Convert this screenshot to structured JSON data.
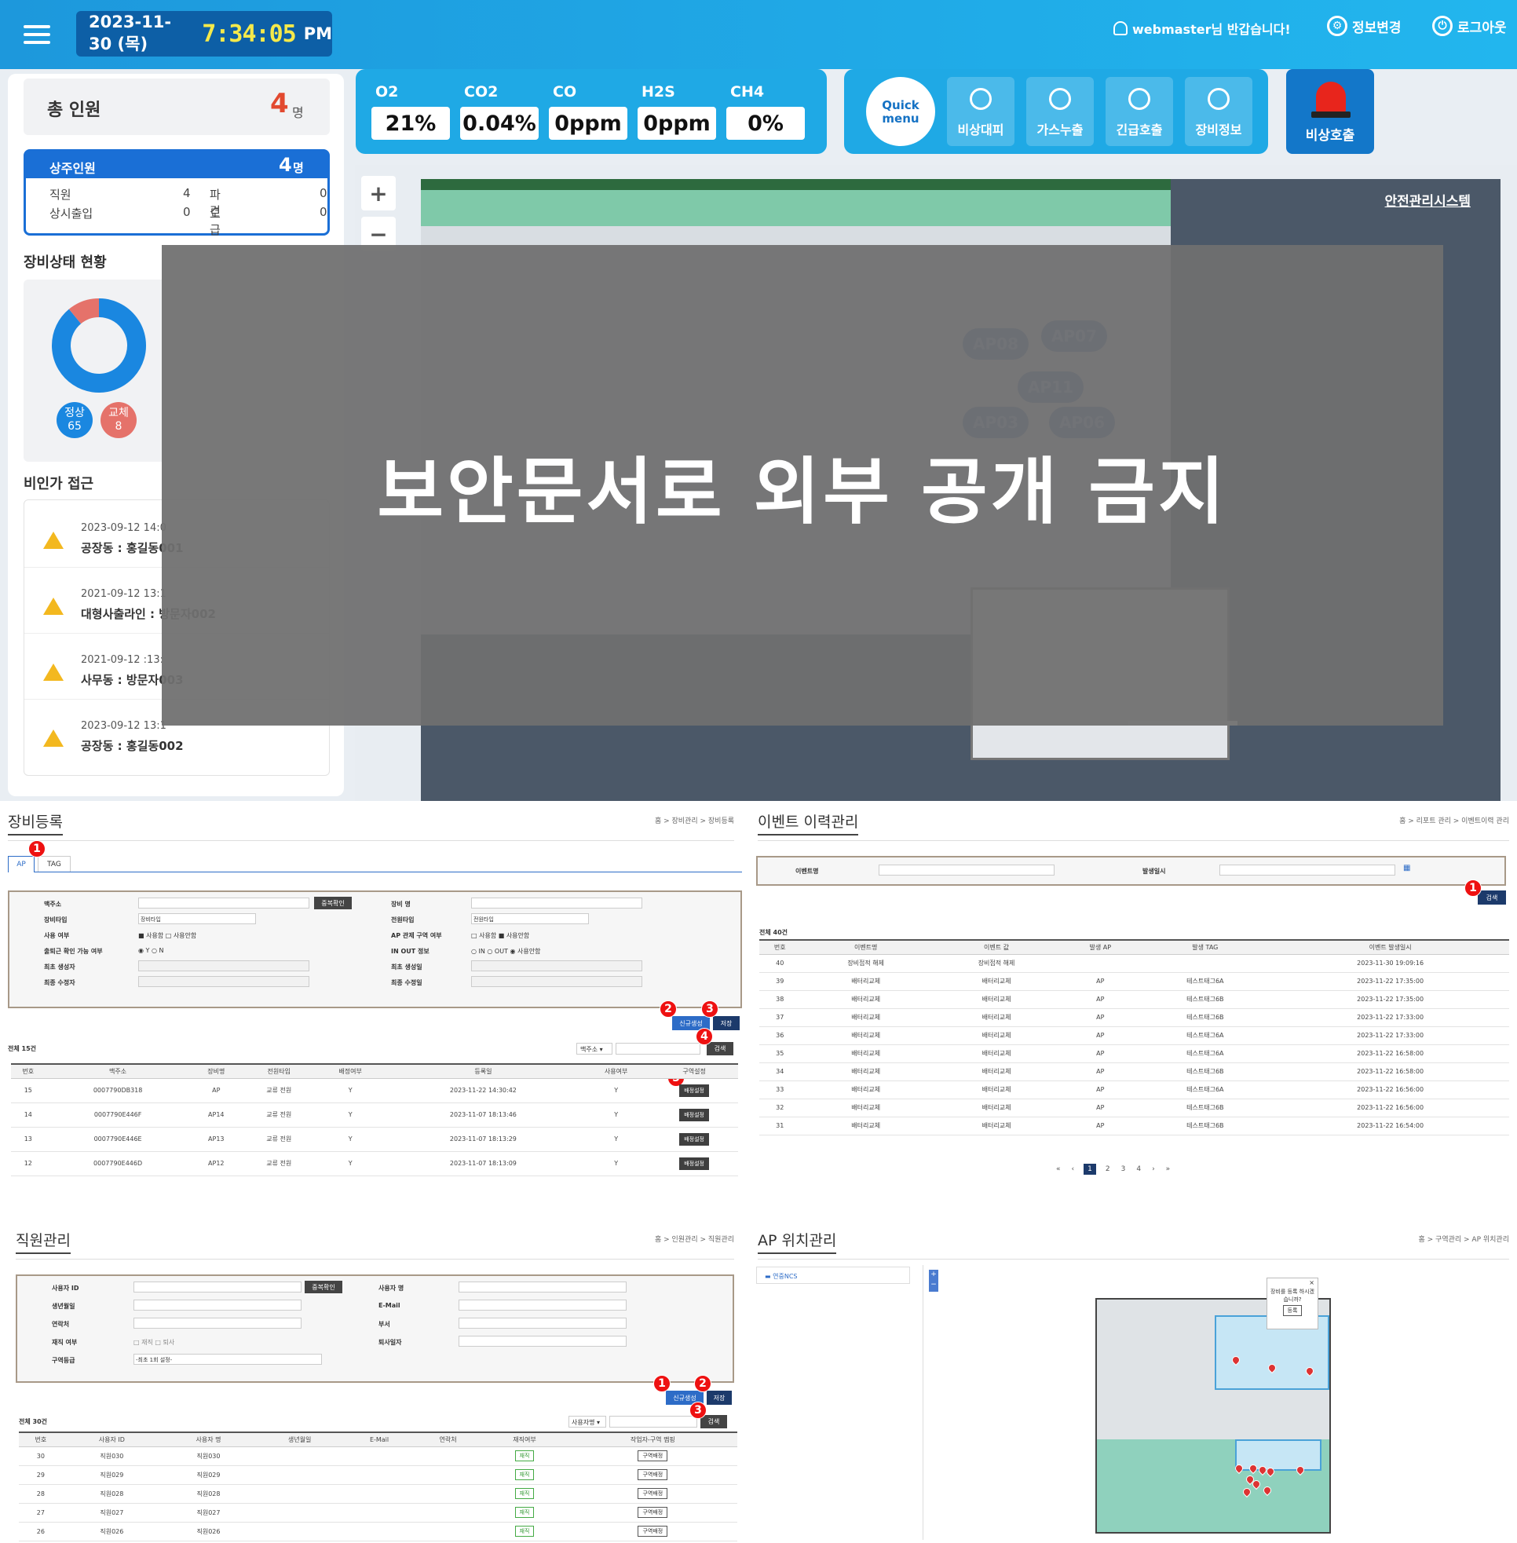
{
  "header": {
    "date": "2023-11-30 (목)",
    "time": "7:34:05",
    "ampm": "PM",
    "user": "webmaster님 반갑습니다!",
    "settings": "정보변경",
    "logout": "로그아웃"
  },
  "total": {
    "label": "총 인원",
    "count": "4",
    "unit": "명"
  },
  "resident": {
    "label": "상주인원",
    "count": "4",
    "unit": "명",
    "rows": [
      {
        "a": "직원",
        "av": "4",
        "b": "파견",
        "bv": "0"
      },
      {
        "a": "상시출입",
        "av": "0",
        "b": "도급",
        "bv": "0"
      }
    ]
  },
  "equip": {
    "title": "장비상태 현황",
    "normal_label": "정상",
    "normal": "65",
    "replace_label": "교체",
    "replace": "8"
  },
  "chart_data": {
    "type": "pie",
    "categories": [
      "정상",
      "교체"
    ],
    "values": [
      65,
      8
    ],
    "colors": [
      "#1a87e0",
      "#e5726a"
    ]
  },
  "intruder": {
    "title": "비인가 접근",
    "items": [
      {
        "time": "2023-09-12 14:0",
        "place": "공장동 : 홍길동001"
      },
      {
        "time": "2021-09-12 13:1",
        "place": "대형사출라인 : 방문자002"
      },
      {
        "time": "2021-09-12 :13:",
        "place": "사무동 : 방문자003"
      },
      {
        "time": "2023-09-12 13:1",
        "place": "공장동 : 홍길동002"
      }
    ]
  },
  "gas": [
    {
      "name": "O2",
      "value": "21%"
    },
    {
      "name": "CO2",
      "value": "0.04%"
    },
    {
      "name": "CO",
      "value": "0ppm"
    },
    {
      "name": "H2S",
      "value": "0ppm"
    },
    {
      "name": "CH4",
      "value": "0%"
    }
  ],
  "quick": {
    "label1": "Quick",
    "label2": "menu",
    "buttons": [
      "비상대피",
      "가스누출",
      "긴급호출",
      "장비정보"
    ],
    "emergency": "비상호출"
  },
  "map": {
    "title": "안전관리시스템",
    "aps": [
      "AP08",
      "AP07",
      "AP11",
      "AP03",
      "AP06"
    ]
  },
  "overlay": "보안문서로 외부 공개 금지",
  "s1": {
    "title": "장비등록",
    "bread": "홈 > 장비관리 > 장비등록",
    "tabs": [
      "AP",
      "TAG"
    ],
    "form": {
      "l": [
        "맥주소",
        "장비타입",
        "사용 여부",
        "출퇴근 확인 가능 여부",
        "최초 생성자",
        "최종 수정자"
      ],
      "r": [
        "장비 명",
        "전원타입",
        "AP 관제 구역 여부",
        "IN OUT 정보",
        "최초 생성일",
        "최종 수정일"
      ],
      "dup": "중복확인",
      "type_sel": "장비타입",
      "power_sel": "전원타입",
      "use": "■ 사용함 □ 사용안함",
      "yn": "◉ Y ○ N",
      "ap_use": "□ 사용함 ■ 사용안함",
      "inout": "○ IN ○ OUT ◉ 사용안함"
    },
    "btn_new": "신규생성",
    "btn_save": "저장",
    "total": "전체 15건",
    "search_sel": "맥주소",
    "search": "검색",
    "cols": [
      "번호",
      "맥주소",
      "장비명",
      "전원타입",
      "배정여부",
      "등록일",
      "사용여부",
      "구역설정"
    ],
    "rows": [
      [
        "15",
        "0007790DB318",
        "AP",
        "교류 전원",
        "Y",
        "2023-11-22 14:30:42",
        "Y",
        "배정설정"
      ],
      [
        "14",
        "0007790E446F",
        "AP14",
        "교류 전원",
        "Y",
        "2023-11-07 18:13:46",
        "Y",
        "배정설정"
      ],
      [
        "13",
        "0007790E446E",
        "AP13",
        "교류 전원",
        "Y",
        "2023-11-07 18:13:29",
        "Y",
        "배정설정"
      ],
      [
        "12",
        "0007790E446D",
        "AP12",
        "교류 전원",
        "Y",
        "2023-11-07 18:13:09",
        "Y",
        "배정설정"
      ]
    ]
  },
  "s2": {
    "title": "이벤트 이력관리",
    "bread": "홈 > 리포트 관리 > 이벤트이력 관리",
    "f1": "이벤트명",
    "f2": "발생일시",
    "search": "검색",
    "total": "전체 40건",
    "cols": [
      "번호",
      "이벤트명",
      "이벤트 값",
      "발생 AP",
      "발생 TAG",
      "이벤트 발생일시"
    ],
    "rows": [
      [
        "40",
        "장비접적 해제",
        "장비접적 해제",
        "",
        "",
        "2023-11-30 19:09:16"
      ],
      [
        "39",
        "배터리교체",
        "배터리교체",
        "AP",
        "테스트태그6A",
        "2023-11-22 17:35:00"
      ],
      [
        "38",
        "배터리교체",
        "배터리교체",
        "AP",
        "테스트태그6B",
        "2023-11-22 17:35:00"
      ],
      [
        "37",
        "배터리교체",
        "배터리교체",
        "AP",
        "테스트태그6B",
        "2023-11-22 17:33:00"
      ],
      [
        "36",
        "배터리교체",
        "배터리교체",
        "AP",
        "테스트태그6A",
        "2023-11-22 17:33:00"
      ],
      [
        "35",
        "배터리교체",
        "배터리교체",
        "AP",
        "테스트태그6A",
        "2023-11-22 16:58:00"
      ],
      [
        "34",
        "배터리교체",
        "배터리교체",
        "AP",
        "테스트태그6B",
        "2023-11-22 16:58:00"
      ],
      [
        "33",
        "배터리교체",
        "배터리교체",
        "AP",
        "테스트태그6A",
        "2023-11-22 16:56:00"
      ],
      [
        "32",
        "배터리교체",
        "배터리교체",
        "AP",
        "테스트태그6B",
        "2023-11-22 16:56:00"
      ],
      [
        "31",
        "배터리교체",
        "배터리교체",
        "AP",
        "테스트태그6B",
        "2023-11-22 16:54:00"
      ]
    ],
    "pages": [
      "«",
      "‹",
      "1",
      "2",
      "3",
      "4",
      "›",
      "»"
    ]
  },
  "s3": {
    "title": "직원관리",
    "bread": "홈 > 인원관리 > 직원관리",
    "form": {
      "l": [
        "사용자 ID",
        "생년월일",
        "연락처",
        "재직 여부",
        "구역등급"
      ],
      "r": [
        "사용자 명",
        "E-Mail",
        "부서",
        "퇴사일자"
      ],
      "dup": "중복확인",
      "work": "□ 재직 □ 퇴사",
      "grade": "-최초 1회 설정-"
    },
    "btn_new": "신규생성",
    "btn_save": "저장",
    "total": "전체 30건",
    "search_sel": "사용자명",
    "search": "검색",
    "cols": [
      "번호",
      "사용자 ID",
      "사용자 명",
      "생년월일",
      "E-Mail",
      "연락처",
      "재직여부",
      "작업자-구역 맵핑"
    ],
    "rows": [
      [
        "30",
        "직원030",
        "직원030",
        "",
        "",
        "",
        "재직",
        "구역배정"
      ],
      [
        "29",
        "직원029",
        "직원029",
        "",
        "",
        "",
        "재직",
        "구역배정"
      ],
      [
        "28",
        "직원028",
        "직원028",
        "",
        "",
        "",
        "재직",
        "구역배정"
      ],
      [
        "27",
        "직원027",
        "직원027",
        "",
        "",
        "",
        "재직",
        "구역배정"
      ],
      [
        "26",
        "직원026",
        "직원026",
        "",
        "",
        "",
        "재직",
        "구역배정"
      ]
    ]
  },
  "s4": {
    "title": "AP 위치관리",
    "bread": "홈 > 구역관리 > AP 위치관리",
    "tree": "연중NCS",
    "popup": "장비를 등록 하시겠습니까?",
    "popup_btn": "등록"
  }
}
